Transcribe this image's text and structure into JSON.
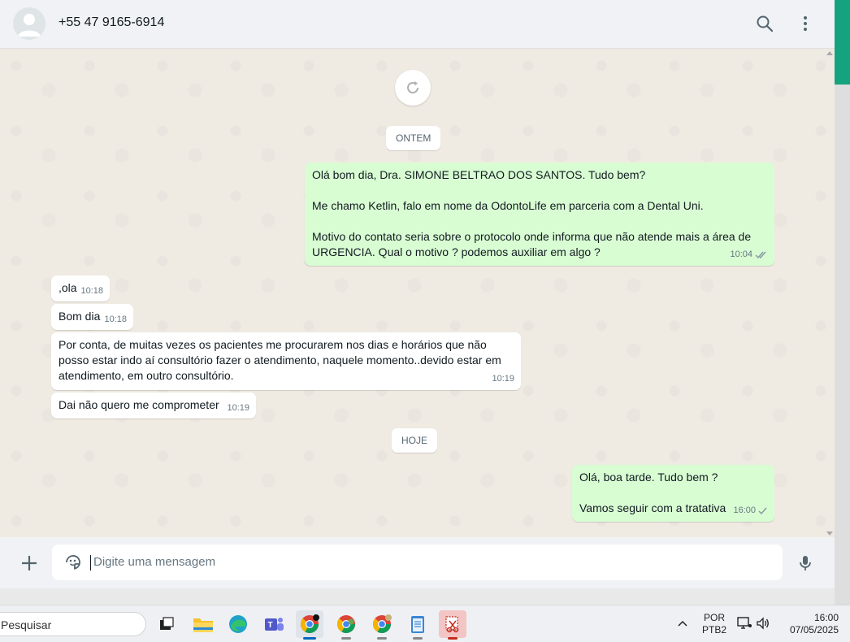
{
  "header": {
    "contact_name": "+55 47 9165-6914",
    "icons": [
      "search-icon",
      "menu-dots-icon",
      "avatar-placeholder-icon"
    ]
  },
  "chat": {
    "date_yesterday": "ONTEM",
    "date_today": "HOJE",
    "messages": [
      {
        "direction": "out",
        "lines": [
          "Olá bom dia, Dra. SIMONE BELTRAO DOS SANTOS. Tudo bem?",
          "",
          "Me chamo Ketlin, falo em nome da OdontoLife em parceria com a Dental Uni.",
          "",
          "Motivo do contato seria sobre o protocolo onde informa que não atende mais a área de",
          "URGENCIA. Qual o motivo ? podemos auxiliar em algo ?"
        ],
        "time": "10:04",
        "status": "read"
      },
      {
        "direction": "in",
        "lines": [
          ",ola"
        ],
        "time": "10:18"
      },
      {
        "direction": "in",
        "lines": [
          "Bom dia"
        ],
        "time": "10:18"
      },
      {
        "direction": "in",
        "lines": [
          "Por conta, de muitas vezes os pacientes me procurarem nos dias e horários que não",
          "posso estar indo aí consultório fazer o atendimento, naquele momento..devido estar em",
          "atendimento, em outro consultório."
        ],
        "time": "10:19"
      },
      {
        "direction": "in",
        "lines": [
          "Dai não quero me comprometer"
        ],
        "time": "10:19"
      },
      {
        "direction": "out",
        "lines": [
          "Olá, boa tarde. Tudo bem ?",
          "",
          "Vamos seguir com a tratativa"
        ],
        "time": "16:00",
        "status": "sent"
      }
    ]
  },
  "composer": {
    "placeholder": "Digite uma mensagem"
  },
  "taskbar": {
    "search_placeholder": "Pesquisar",
    "lang_top": "POR",
    "lang_bottom": "PTB2",
    "time": "16:00",
    "date": "07/05/2025"
  },
  "colors": {
    "outgoing_bubble": "#d9fdd3",
    "incoming_bubble": "#ffffff",
    "chat_background": "#efeae2",
    "accent": "#15a37f"
  }
}
